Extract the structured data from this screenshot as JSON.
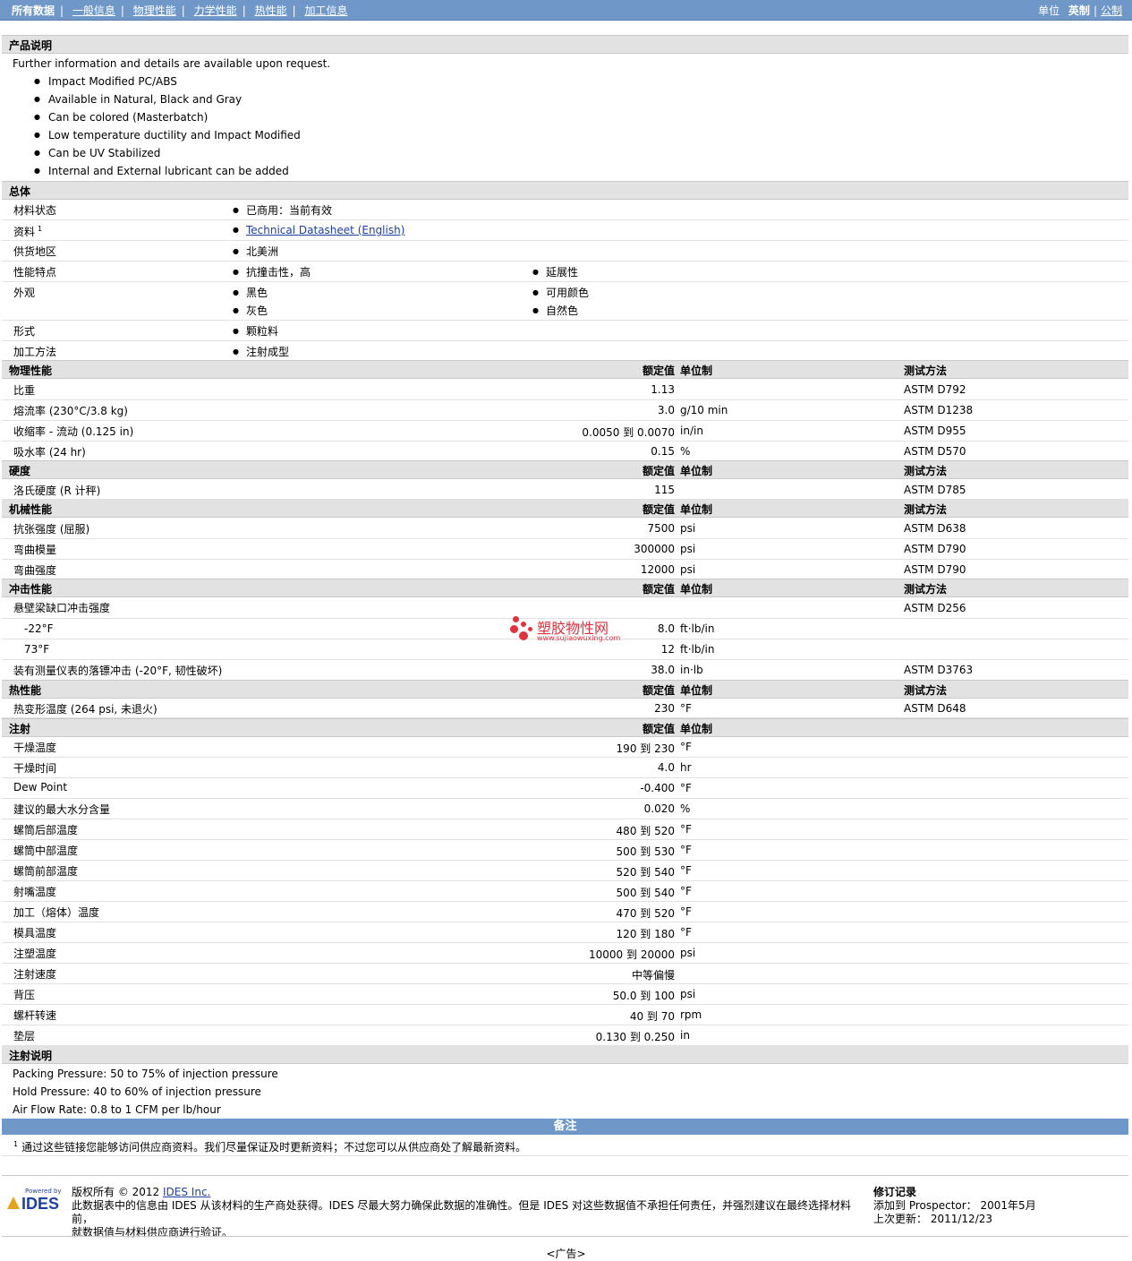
{
  "nav": {
    "items": [
      "所有数据",
      "一般信息",
      "物理性能",
      "力学性能",
      "热性能",
      "加工信息"
    ],
    "units_label": "单位",
    "units_imperial": "英制",
    "units_metric": "公制"
  },
  "description": {
    "heading": "产品说明",
    "intro": "Further information and details are available upon request.",
    "bullets": [
      "Impact Modified PC/ABS",
      "Available in Natural, Black and Gray",
      "Can be colored (Masterbatch)",
      "Low temperature ductility and Impact Modified",
      "Can be UV Stabilized",
      "Internal and External lubricant can be added"
    ]
  },
  "general": {
    "heading": "总体",
    "status_label": "材料状态",
    "status_value": "已商用：当前有效",
    "docs_label": "资料",
    "docs_sup": "1",
    "docs_link": "Technical Datasheet (English)",
    "region_label": "供货地区",
    "region_value": "北美洲",
    "features_label": "性能特点",
    "features_1": "抗撞击性，高",
    "features_2": "延展性",
    "appearance_label": "外观",
    "appearance_1": "黑色",
    "appearance_2": "可用颜色",
    "appearance_3": "灰色",
    "appearance_4": "自然色",
    "form_label": "形式",
    "form_value": "颗粒料",
    "process_label": "加工方法",
    "process_value": "注射成型"
  },
  "headers": {
    "value": "额定值",
    "unit": "单位制",
    "method": "测试方法"
  },
  "physical": {
    "heading": "物理性能",
    "rows": [
      {
        "label": "比重",
        "value": "1.13",
        "unit": "",
        "method": "ASTM D792"
      },
      {
        "label": "熔流率  (230°C/3.8 kg)",
        "value": "3.0",
        "unit": "g/10 min",
        "method": "ASTM D1238"
      },
      {
        "label": "收缩率  - 流动  (0.125 in)",
        "value": "0.0050 到  0.0070",
        "unit": "in/in",
        "method": "ASTM D955"
      },
      {
        "label": "吸水率  (24 hr)",
        "value": "0.15",
        "unit": "%",
        "method": "ASTM D570"
      }
    ]
  },
  "hardness": {
    "heading": "硬度",
    "rows": [
      {
        "label": "洛氏硬度  (R 计秤)",
        "value": "115",
        "unit": "",
        "method": "ASTM D785"
      }
    ]
  },
  "mechanical": {
    "heading": "机械性能",
    "rows": [
      {
        "label": "抗张强度  (屈服)",
        "value": "7500",
        "unit": "psi",
        "method": "ASTM D638"
      },
      {
        "label": "弯曲模量",
        "value": "300000",
        "unit": "psi",
        "method": "ASTM D790"
      },
      {
        "label": "弯曲强度",
        "value": "12000",
        "unit": "psi",
        "method": "ASTM D790"
      }
    ]
  },
  "impact": {
    "heading": "冲击性能",
    "izod_label": "悬壁梁缺口冲击强度",
    "izod_method": "ASTM D256",
    "r1_label": "-22°F",
    "r1_value": "8.0",
    "r1_unit": "ft·lb/in",
    "r2_label": "73°F",
    "r2_value": "12",
    "r2_unit": "ft·lb/in",
    "dart_label": "装有测量仪表的落镖冲击  (-20°F, 韧性破坏)",
    "dart_value": "38.0",
    "dart_unit": "in·lb",
    "dart_method": "ASTM D3763"
  },
  "thermal": {
    "heading": "热性能",
    "rows": [
      {
        "label": "热变形温度  (264 psi, 未退火)",
        "value": "230",
        "unit": "°F",
        "method": "ASTM D648"
      }
    ]
  },
  "injection": {
    "heading": "注射",
    "rows": [
      {
        "label": "干燥温度",
        "value": "190 到  230",
        "unit": "°F"
      },
      {
        "label": "干燥时间",
        "value": "4.0",
        "unit": "hr"
      },
      {
        "label": "Dew Point",
        "value": "-0.400",
        "unit": "°F"
      },
      {
        "label": "建议的最大水分含量",
        "value": "0.020",
        "unit": "%"
      },
      {
        "label": "螺筒后部温度",
        "value": "480 到  520",
        "unit": "°F"
      },
      {
        "label": "螺筒中部温度",
        "value": "500 到  530",
        "unit": "°F"
      },
      {
        "label": "螺筒前部温度",
        "value": "520 到  540",
        "unit": "°F"
      },
      {
        "label": "射嘴温度",
        "value": "500 到  540",
        "unit": "°F"
      },
      {
        "label": "加工（熔体）温度",
        "value": "470 到  520",
        "unit": "°F"
      },
      {
        "label": "模具温度",
        "value": "120 到  180",
        "unit": "°F"
      },
      {
        "label": "注塑温度",
        "value": "10000 到  20000",
        "unit": "psi"
      },
      {
        "label": "注射速度",
        "value": "中等偏慢",
        "unit": ""
      },
      {
        "label": "背压",
        "value": "50.0 到  100",
        "unit": "psi"
      },
      {
        "label": "螺杆转速",
        "value": "40 到  70",
        "unit": "rpm"
      },
      {
        "label": "垫层",
        "value": "0.130 到  0.250",
        "unit": "in"
      }
    ]
  },
  "injection_notes": {
    "heading": "注射说明",
    "lines": [
      "Packing Pressure: 50 to 75% of injection pressure",
      "Hold Pressure: 40 to 60% of injection pressure",
      "Air Flow Rate: 0.8 to 1 CFM per lb/hour"
    ]
  },
  "notes": {
    "heading": "备注",
    "sup": "1",
    "text": "通过这些链接您能够访问供应商资料。我们尽量保证及时更新资料；不过您可以从供应商处了解最新资料。"
  },
  "watermark": {
    "text": "塑胶物性网",
    "sub": "www.sujiaowuxing.com"
  },
  "footer": {
    "logo_powered": "Powered by",
    "logo_name": "IDES",
    "copyright": "版权所有 © 2012",
    "ides_link": "IDES Inc.",
    "disclaimer_1": "此数据表中的信息由 IDES 从该材料的生产商处获得。IDES 尽最大努力确保此数据的准确性。但是 IDES 对这些数据值不承担任何责任，并强烈建议在最终选择材料前，",
    "disclaimer_2": "就数据值与材料供应商进行验证。",
    "rev_heading": "修订记录",
    "added_label": "添加到 Prospector：",
    "added_value": "2001年5月",
    "updated_label": "上次更新：",
    "updated_value": "2011/12/23",
    "ad": "<广告>"
  }
}
